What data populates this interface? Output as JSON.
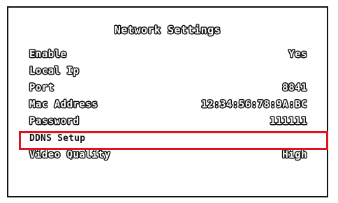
{
  "menu": {
    "title": "Network Settings",
    "items": [
      {
        "label": "Enable",
        "value": "Yes"
      },
      {
        "label": "Local Ip",
        "value": ""
      },
      {
        "label": "Port",
        "value": "8841"
      },
      {
        "label": "Mac Address",
        "value": "12:34:56:78:9A:BC"
      },
      {
        "label": "Password",
        "value": "111111"
      },
      {
        "label": "DDNS Setup",
        "value": ""
      },
      {
        "label": "Video Quality",
        "value": "High"
      }
    ],
    "highlighted_item": "DDNS Setup"
  },
  "colors": {
    "background": "#ffffff",
    "text_fill": "#ffffff",
    "text_outline": "#111111",
    "highlight": "#e0141c"
  }
}
